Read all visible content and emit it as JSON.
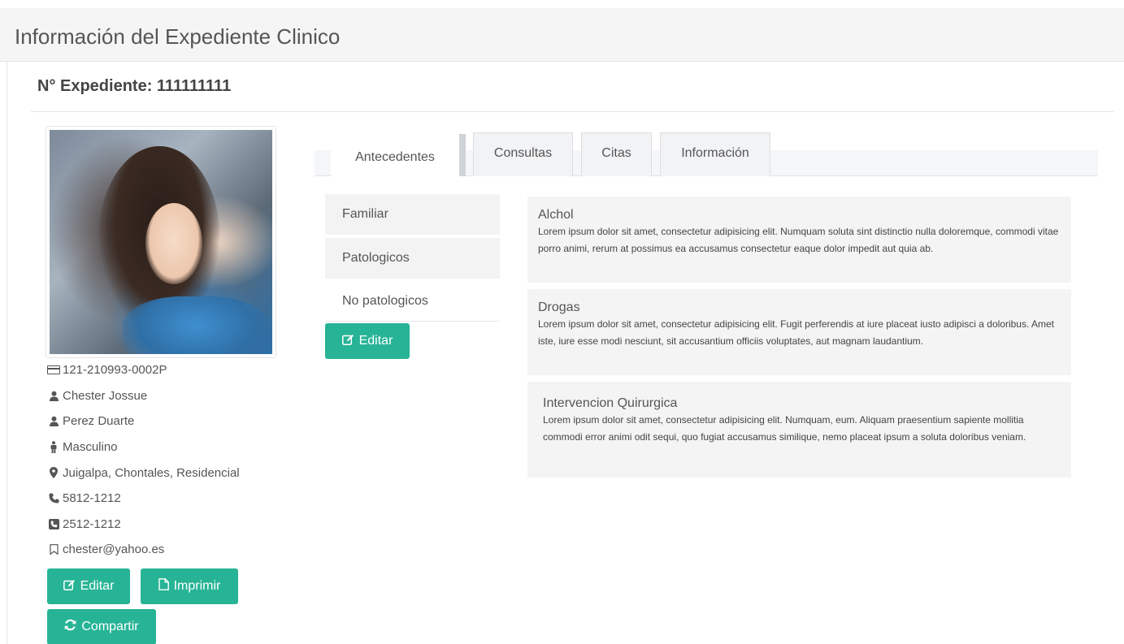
{
  "page": {
    "title": "Información del Expediente Clinico"
  },
  "expediente": {
    "title": "N° Expediente: 111111111"
  },
  "patient": {
    "photo_alt": "",
    "info": [
      {
        "icon": "id-card-icon",
        "text": "121-210993-0002P"
      },
      {
        "icon": "user-icon",
        "text": "Chester Jossue"
      },
      {
        "icon": "user-icon",
        "text": "Perez Duarte"
      },
      {
        "icon": "male-icon",
        "text": "Masculino"
      },
      {
        "icon": "map-marker-icon",
        "text": "Juigalpa, Chontales, Residencial"
      },
      {
        "icon": "phone-icon",
        "text": "5812-1212"
      },
      {
        "icon": "phone-square-icon",
        "text": "2512-1212"
      },
      {
        "icon": "bookmark-icon",
        "text": "chester@yahoo.es"
      }
    ]
  },
  "buttons": {
    "editar": "Editar",
    "imprimir": "Imprimir",
    "compartir": "Compartir",
    "editar_antecedentes": "Editar"
  },
  "tabs": [
    {
      "label": "Antecedentes",
      "active": true
    },
    {
      "label": "Consultas",
      "active": false
    },
    {
      "label": "Citas",
      "active": false
    },
    {
      "label": "Información",
      "active": false
    }
  ],
  "subnav": [
    {
      "label": "Familiar"
    },
    {
      "label": "Patologicos"
    },
    {
      "label": "No patologicos",
      "active": true
    }
  ],
  "panels": [
    {
      "title": "Alchol",
      "body": "Lorem ipsum dolor sit amet, consectetur adipisicing elit. Numquam soluta sint distinctio nulla doloremque, commodi vitae porro animi, rerum at possimus ea accusamus consectetur eaque dolor impedit aut quia ab."
    },
    {
      "title": "Drogas",
      "body": "Lorem ipsum dolor sit amet, consectetur adipisicing elit. Fugit perferendis at iure placeat iusto adipisci a doloribus. Amet iste, iure esse modi nesciunt, sit accusantium officiis voluptates, aut magnam laudantium."
    },
    {
      "title": "Intervencion Quirurgica",
      "body": "Lorem ipsum dolor sit amet, consectetur adipisicing elit. Numquam, eum. Aliquam praesentium sapiente mollitia commodi error animi odit sequi, quo fugiat accusamus similique, nemo placeat ipsum a soluta doloribus veniam."
    }
  ],
  "colors": {
    "accent": "#27b496",
    "panel_bg": "#f4f4f5",
    "header_bg": "#f5f5f5"
  }
}
